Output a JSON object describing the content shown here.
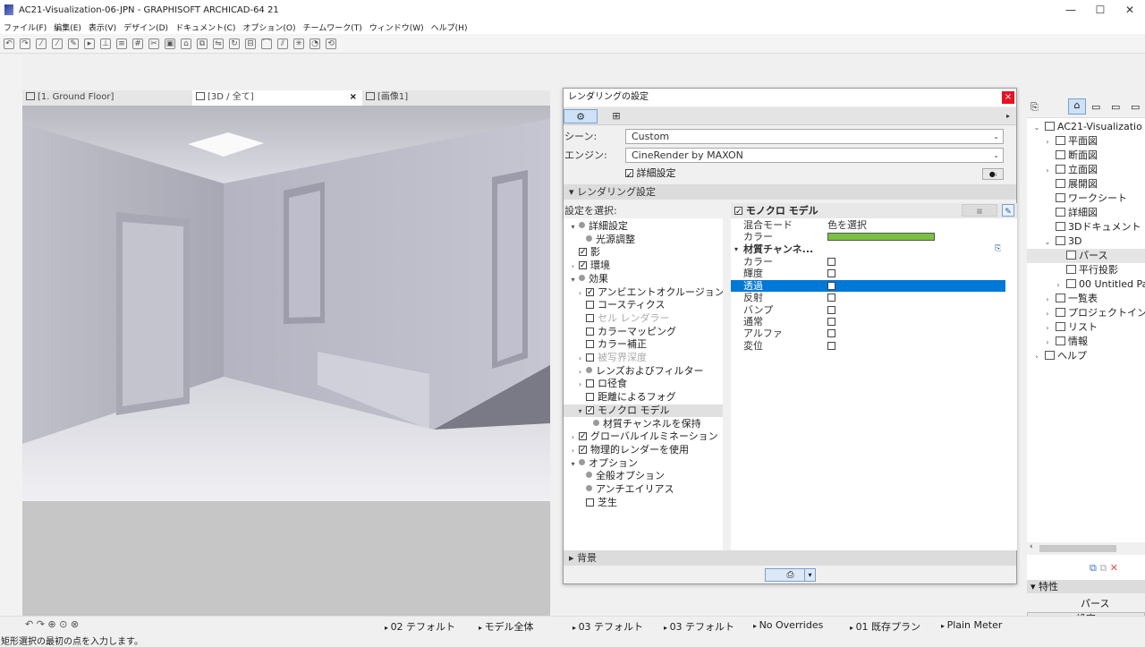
{
  "window": {
    "title": "AC21-Visualization-06-JPN - GRAPHISOFT ARCHICAD-64 21"
  },
  "menu": [
    "ファイル(F)",
    "編集(E)",
    "表示(V)",
    "デザイン(D)",
    "ドキュメント(C)",
    "オプション(O)",
    "チームワーク(T)",
    "ウィンドウ(W)",
    "ヘルプ(H)"
  ],
  "tabs": [
    {
      "label": "[1. Ground Floor]",
      "icon": "floor-plan-icon"
    },
    {
      "label": "[3D / 全て]",
      "icon": "3d-view-icon",
      "close": "×"
    },
    {
      "label": "[画像1]",
      "icon": "camera-icon"
    }
  ],
  "dialog": {
    "title": "レンダリングの設定",
    "close": "×",
    "scene_label": "シーン:",
    "scene_value": "Custom",
    "engine_label": "エンジン:",
    "engine_value": "CineRender by MAXON",
    "detail_label": "詳細設定",
    "section_render": "レンダリング設定",
    "tree_header": "設定を選択:",
    "tree": [
      {
        "label": "詳細設定",
        "type": "bullet",
        "indent": 0,
        "exp": "▾"
      },
      {
        "label": "光源調整",
        "type": "bullet",
        "indent": 1
      },
      {
        "label": "影",
        "type": "check",
        "on": true,
        "indent": 0
      },
      {
        "label": "環境",
        "type": "check",
        "on": true,
        "indent": 0,
        "exp": "›"
      },
      {
        "label": "効果",
        "type": "bullet",
        "indent": 0,
        "exp": "▾"
      },
      {
        "label": "アンビエントオクルージョン",
        "type": "check",
        "on": true,
        "indent": 1,
        "exp": "›"
      },
      {
        "label": "コースティクス",
        "type": "check",
        "on": false,
        "indent": 1
      },
      {
        "label": "セル レンダラー",
        "type": "check",
        "on": false,
        "indent": 1,
        "dis": true
      },
      {
        "label": "カラーマッピング",
        "type": "check",
        "on": false,
        "indent": 1
      },
      {
        "label": "カラー補正",
        "type": "check",
        "on": false,
        "indent": 1
      },
      {
        "label": "被写界深度",
        "type": "check",
        "on": false,
        "indent": 1,
        "exp": "›",
        "dis": true
      },
      {
        "label": "レンズおよびフィルター",
        "type": "bullet",
        "indent": 1,
        "exp": "›"
      },
      {
        "label": "ロ径食",
        "type": "check",
        "on": false,
        "indent": 1,
        "exp": "›"
      },
      {
        "label": "距離によるフォグ",
        "type": "check",
        "on": false,
        "indent": 1
      },
      {
        "label": "モノクロ モデル",
        "type": "check",
        "on": true,
        "indent": 1,
        "exp": "▾",
        "sel": true
      },
      {
        "label": "材質チャンネルを保持",
        "type": "bullet",
        "indent": 2
      },
      {
        "label": "グローバルイルミネーション",
        "type": "check",
        "on": true,
        "indent": 0,
        "exp": "›"
      },
      {
        "label": "物理的レンダーを使用",
        "type": "check",
        "on": true,
        "indent": 0,
        "exp": "›"
      },
      {
        "label": "オプション",
        "type": "bullet",
        "indent": 0,
        "exp": "▾"
      },
      {
        "label": "全般オプション",
        "type": "bullet",
        "indent": 1
      },
      {
        "label": "アンチエイリアス",
        "type": "bullet",
        "indent": 1
      },
      {
        "label": "芝生",
        "type": "check",
        "on": false,
        "indent": 1
      }
    ],
    "prop_header": "モノクロ モデル",
    "blend_label": "混合モード",
    "blend_value": "色を選択",
    "color_label": "カラー",
    "color_value": "#7ac142",
    "channels_label": "材質チャンネ...",
    "channels": [
      {
        "label": "カラー",
        "sel": false
      },
      {
        "label": "輝度",
        "sel": false
      },
      {
        "label": "透過",
        "sel": true
      },
      {
        "label": "反射",
        "sel": false
      },
      {
        "label": "バンプ",
        "sel": false
      },
      {
        "label": "通常",
        "sel": false
      },
      {
        "label": "アルファ",
        "sel": false
      },
      {
        "label": "変位",
        "sel": false
      }
    ],
    "section_bg": "背景"
  },
  "navigator": {
    "items": [
      {
        "label": "AC21-Visualizatio",
        "indent": 0,
        "exp": "⌄",
        "icon": "project-icon"
      },
      {
        "label": "平面図",
        "indent": 1,
        "exp": "›",
        "icon": "plan-icon"
      },
      {
        "label": "断面図",
        "indent": 1,
        "exp": "",
        "icon": "section-icon"
      },
      {
        "label": "立面図",
        "indent": 1,
        "exp": "›",
        "icon": "elevation-icon"
      },
      {
        "label": "展開図",
        "indent": 1,
        "exp": "",
        "icon": "interior-elevation-icon"
      },
      {
        "label": "ワークシート",
        "indent": 1,
        "exp": "",
        "icon": "worksheet-icon"
      },
      {
        "label": "詳細図",
        "indent": 1,
        "exp": "",
        "icon": "detail-icon"
      },
      {
        "label": "3Dドキュメント",
        "indent": 1,
        "exp": "",
        "icon": "3d-document-icon"
      },
      {
        "label": "3D",
        "indent": 1,
        "exp": "⌄",
        "icon": "3d-icon"
      },
      {
        "label": "パース",
        "indent": 2,
        "exp": "",
        "icon": "perspective-icon",
        "sel": true
      },
      {
        "label": "平行投影",
        "indent": 2,
        "exp": "",
        "icon": "axonometry-icon"
      },
      {
        "label": "00 Untitled Pat",
        "indent": 2,
        "exp": "›",
        "icon": "path-icon"
      },
      {
        "label": "一覧表",
        "indent": 1,
        "exp": "›",
        "icon": "schedule-icon"
      },
      {
        "label": "プロジェクトイン",
        "indent": 1,
        "exp": "›",
        "icon": "project-index-icon"
      },
      {
        "label": "リスト",
        "indent": 1,
        "exp": "›",
        "icon": "list-icon"
      },
      {
        "label": "情報",
        "indent": 1,
        "exp": "›",
        "icon": "info-icon"
      },
      {
        "label": "ヘルプ",
        "indent": 0,
        "exp": "›",
        "icon": "help-icon"
      }
    ],
    "props_title": "特性",
    "props_value": "パース",
    "props_button": "設定"
  },
  "status": {
    "items": [
      "02 テフォルト",
      "モデル全体",
      "03 テフォルト",
      "03 テフォルト",
      "No Overrides",
      "01 既存プラン",
      "Plain Meter"
    ],
    "hint": "矩形選択の最初の点を入力します。"
  }
}
